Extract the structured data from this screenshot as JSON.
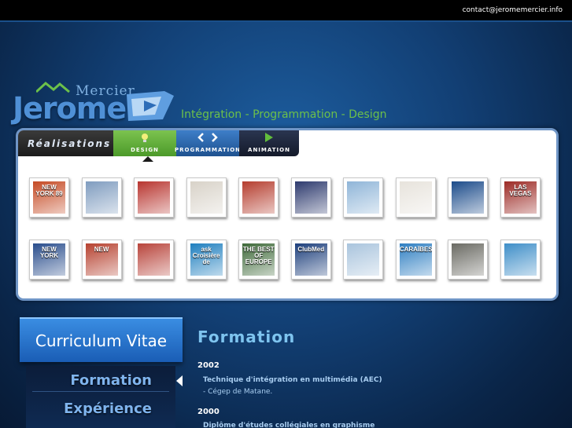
{
  "header": {
    "contact_email": "contact@jeromemercier.info"
  },
  "logo": {
    "first": "Jerome",
    "last": "Mercier"
  },
  "tagline": "Intégration - Programmation - Design",
  "portfolio": {
    "section_label": "Réalisations",
    "tabs": [
      {
        "label": "DESIGN",
        "icon": "lightbulb-icon"
      },
      {
        "label": "PROGRAMMATION",
        "icon": "code-brackets-icon"
      },
      {
        "label": "ANIMATION",
        "icon": "play-icon"
      }
    ],
    "thumbs_row1": [
      {
        "text": "NEW YORK 89",
        "bg": "#c54a24"
      },
      {
        "text": "",
        "bg": "#7f9cbf"
      },
      {
        "text": "",
        "bg": "#b8352f"
      },
      {
        "text": "",
        "bg": "#d8d2c8"
      },
      {
        "text": "",
        "bg": "#b53d2e"
      },
      {
        "text": "",
        "bg": "#2d3a6e"
      },
      {
        "text": "",
        "bg": "#8fb5d8"
      },
      {
        "text": "",
        "bg": "#e7e3dc"
      },
      {
        "text": "",
        "bg": "#1b4b8a"
      },
      {
        "text": "LAS VEGAS",
        "bg": "#9c2a25"
      }
    ],
    "thumbs_row2": [
      {
        "text": "NEW YORK",
        "bg": "#294d8c"
      },
      {
        "text": "NEW",
        "bg": "#b6412f"
      },
      {
        "text": "",
        "bg": "#b8443b"
      },
      {
        "text": "ask Croisière de",
        "bg": "#1f7fbf"
      },
      {
        "text": "THE BEST OF EUROPE",
        "bg": "#3f6a3a"
      },
      {
        "text": "ClubMed",
        "bg": "#1d3f7c"
      },
      {
        "text": "",
        "bg": "#a9c4dd"
      },
      {
        "text": "CARAÏBES",
        "bg": "#2f7fc2"
      },
      {
        "text": "",
        "bg": "#6a6a63"
      },
      {
        "text": "",
        "bg": "#3e8ec8"
      }
    ]
  },
  "cv": {
    "title": "Curriculum Vitae",
    "menu": [
      {
        "label": "Formation"
      },
      {
        "label": "Expérience"
      }
    ]
  },
  "formation": {
    "title": "Formation",
    "entries": [
      {
        "year": "2002",
        "title": "Technique d'intégration en multimédia (AEC)",
        "sub": "- Cégep de Matane."
      },
      {
        "year": "2000",
        "title": "Diplôme d'études collégiales en graphisme",
        "sub": ""
      }
    ]
  }
}
